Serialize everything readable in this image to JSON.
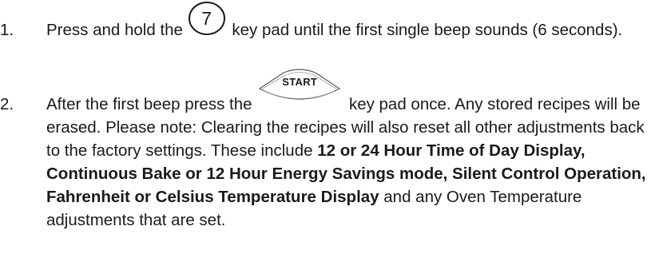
{
  "steps": [
    {
      "number": "1.",
      "before_key": "Press and hold the",
      "key_label": "7",
      "after_key": "key pad until the first single beep sounds (6 seconds)."
    },
    {
      "number": "2.",
      "before_key": "After the first beep press the",
      "key_label": "START",
      "after_key": "key pad once. Any stored recipes will be erased. Please note: Clearing the recipes will also reset all other adjustments back to the factory settings. These include",
      "bold_1": "12 or 24 Hour Time of Day Display, Continuous Bake or 12 Hour Energy Savings mode, Silent Control Operation, Fahrenheit or Celsius Temperature Display",
      "tail": "and any Oven Temperature adjustments that are set."
    }
  ],
  "icons": {
    "key_7": "circle-key-icon",
    "key_start": "start-key-icon"
  }
}
